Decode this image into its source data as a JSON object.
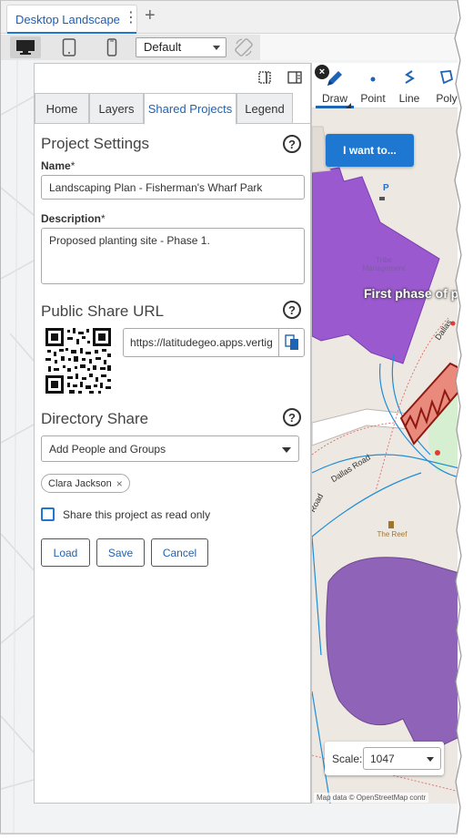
{
  "browser": {
    "tab_label": "Desktop Landscape",
    "kebab": "⋮",
    "new_tab": "+"
  },
  "device_toolbar": {
    "devices": [
      "desktop-icon",
      "tablet-icon",
      "phone-icon"
    ],
    "preset": "Default"
  },
  "panel": {
    "tabs": [
      "Home",
      "Layers",
      "Shared Projects",
      "Legend"
    ],
    "active_tab": "Shared Projects",
    "project_settings": {
      "title": "Project Settings",
      "help": "?",
      "name_label": "Name",
      "name_value": "Landscaping Plan - Fisherman's Wharf Park",
      "description_label": "Description",
      "description_value": "Proposed planting site - Phase 1.",
      "required_mark": "*"
    },
    "public_share": {
      "title": "Public Share URL",
      "help": "?",
      "url": "https://latitudegeo.apps.vertig"
    },
    "directory_share": {
      "title": "Directory Share",
      "help": "?",
      "dropdown_value": "Add People and Groups",
      "chip": "Clara Jackson",
      "chip_remove": "×",
      "read_only_label": "Share this project as read only"
    },
    "buttons": {
      "load": "Load",
      "save": "Save",
      "cancel": "Cancel"
    }
  },
  "map": {
    "tools": [
      "Draw",
      "Point",
      "Line",
      "Poly"
    ],
    "close": "×",
    "i_want_to": "I want to...",
    "feature_label": "First phase of p",
    "streets": [
      "Dallas Road",
      "Road",
      "Dallas"
    ],
    "pois": [
      "Tribe Management",
      "The Reef"
    ],
    "scale_label": "Scale:",
    "scale_value": "1047",
    "attribution": "Map data © OpenStreetMap contr"
  },
  "colors": {
    "accent": "#1e78d2",
    "tab_active_text": "#1e63b4",
    "building_purple": "#9b59d0",
    "feature_red": "#e25b4f",
    "map_bg": "#ede8e1"
  }
}
